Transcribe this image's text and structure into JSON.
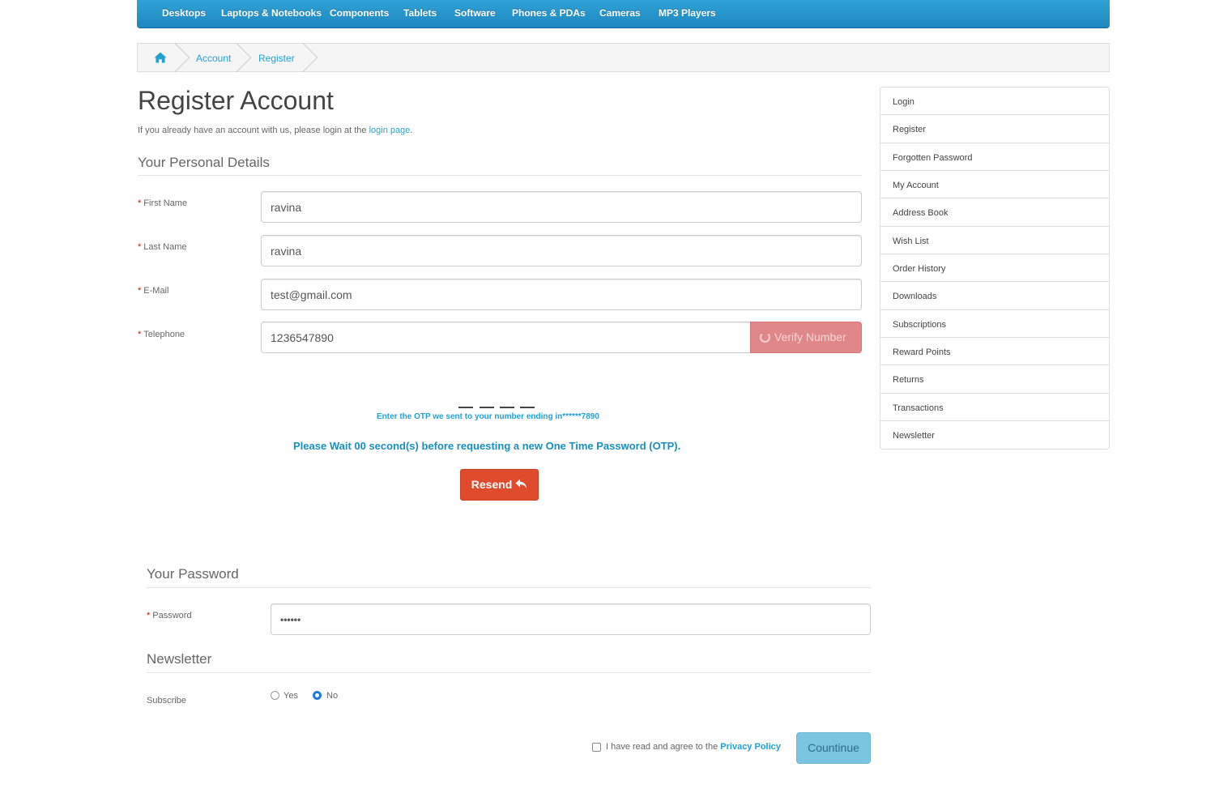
{
  "top_menu": {
    "items": [
      "Desktops",
      "Laptops & Notebooks",
      "Components",
      "Tablets",
      "Software",
      "Phones & PDAs",
      "Cameras",
      "MP3 Players"
    ]
  },
  "breadcrumb": {
    "home_icon": "home-icon",
    "items": [
      "Account",
      "Register"
    ]
  },
  "page": {
    "title": "Register Account",
    "intro_text": "If you already have an account with us, please login at the ",
    "intro_link": "login page",
    "intro_end": "."
  },
  "personal_details": {
    "legend": "Your Personal Details",
    "required_mark": "*",
    "first_name": {
      "label": "First Name",
      "value": "ravina"
    },
    "last_name": {
      "label": "Last Name",
      "value": "ravina"
    },
    "email": {
      "label": "E-Mail",
      "value": "test@gmail.com"
    },
    "telephone": {
      "label": "Telephone",
      "value": "1236547890"
    },
    "verify_button": "Verify Number"
  },
  "otp": {
    "boxes": [
      "",
      "",
      "",
      ""
    ],
    "instruction": "Enter the OTP we sent to your number ending in******7890",
    "wait_message": "Please Wait 00 second(s) before requesting a new One Time Password (OTP).",
    "resend_button": "Resend",
    "resend_icon": "reply-icon"
  },
  "password_section": {
    "legend": "Your Password",
    "password": {
      "label": "Password",
      "value": "••••••"
    }
  },
  "newsletter": {
    "legend": "Newsletter",
    "subscribe_label": "Subscribe",
    "yes_label": "Yes",
    "no_label": "No",
    "selected": "No"
  },
  "footer": {
    "agree_text": "I have read and agree to the ",
    "privacy_link": "Privacy Policy",
    "agree_checked": false,
    "continue_button": "Countinue"
  },
  "sidebar": {
    "items": [
      "Login",
      "Register",
      "Forgotten Password",
      "My Account",
      "Address Book",
      "Wish List",
      "Order History",
      "Downloads",
      "Subscriptions",
      "Reward Points",
      "Returns",
      "Transactions",
      "Newsletter"
    ]
  },
  "colors": {
    "accent": "#23a1d1",
    "menu_bg": "#229ac8",
    "resend": "#e04b2d",
    "verify": "#e0878a",
    "continue": "#7bc5e0"
  }
}
